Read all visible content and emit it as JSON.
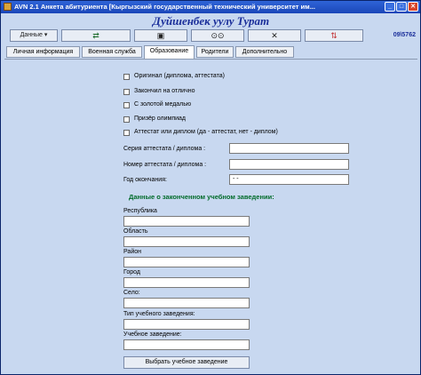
{
  "window": {
    "title": "AVN 2.1 Анкета абитуриента [Кыргызский государственный технический университет им...",
    "minimize": "_",
    "maximize": "□",
    "close": "✕"
  },
  "banner": {
    "name": "Дуйшенбек уулу  Турат"
  },
  "toolbar": {
    "data_label": "Данные  ▾",
    "transfer_icon": "⇄",
    "save_icon": "▣",
    "find_icon": "⊙⊙",
    "delete_icon": "✕",
    "swap_icon": "⇅",
    "code": "09\\5762"
  },
  "tabs": [
    "Личная информация",
    "Военная служба",
    "Образование",
    "Родители",
    "Дополнительно"
  ],
  "education": {
    "checkboxes": [
      "Оригинал (диплома, аттестата)",
      "Закончил на отлично",
      "С золотой медалью",
      "Призёр олимпиад",
      "Аттестат или диплом (да - аттестат, нет - диплом)"
    ],
    "fields": {
      "series_label": "Серия аттестата / диплома :",
      "series_value": "",
      "number_label": "Номер аттестата / диплома :",
      "number_value": "",
      "year_label": "Год окончания:",
      "year_value": "  -  -"
    },
    "section_title": "Данные о законченном учебном заведении:",
    "institution": [
      {
        "label": "Республика",
        "value": ""
      },
      {
        "label": "Область",
        "value": ""
      },
      {
        "label": "Район",
        "value": ""
      },
      {
        "label": "Город",
        "value": ""
      },
      {
        "label": "Село:",
        "value": ""
      },
      {
        "label": "Тип учебного заведения:",
        "value": ""
      },
      {
        "label": "Учебное заведение:",
        "value": ""
      }
    ],
    "choose_button": "Выбрать учебное заведение"
  }
}
